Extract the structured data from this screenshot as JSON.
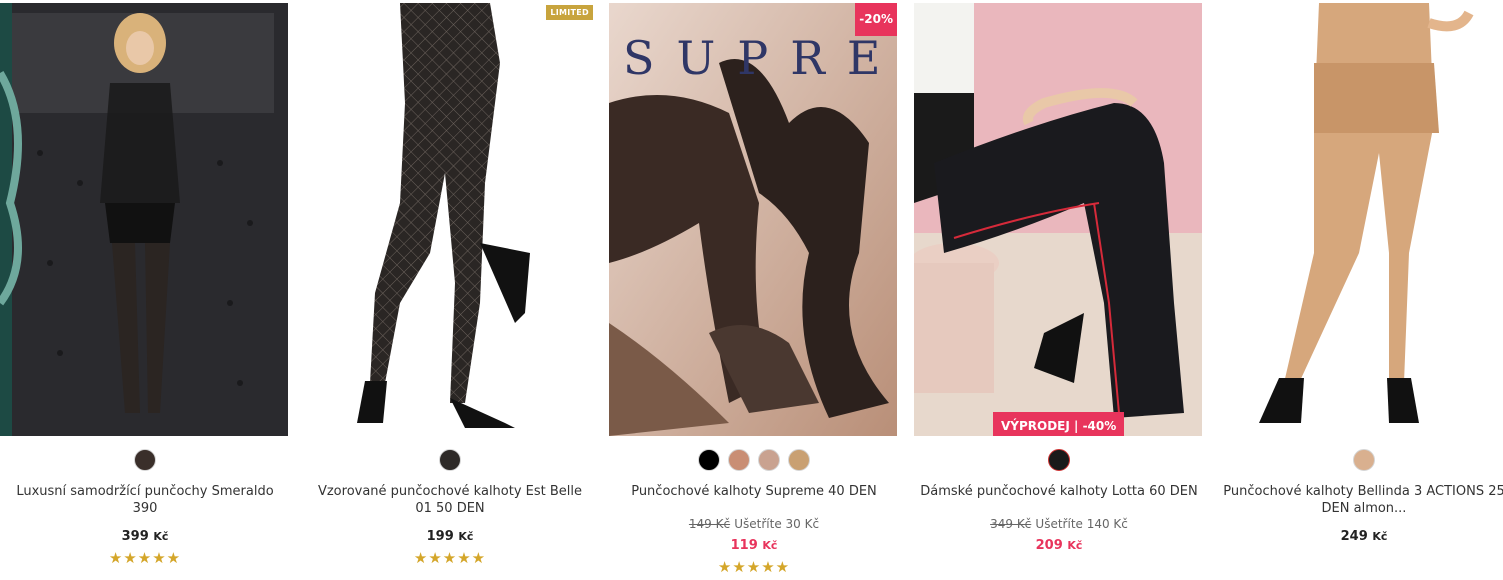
{
  "products": [
    {
      "name": "Luxusní samodržící punčochy Smeraldo 390",
      "price": "399",
      "currency": "Kč",
      "rating": 5,
      "stars": "★★★★★",
      "swatches": [
        "#3a2f2a"
      ]
    },
    {
      "name": "Vzorované punčochové kalhoty Est Belle 01 50 DEN",
      "price": "199",
      "currency": "Kč",
      "badge": "LIMITED",
      "rating": 5,
      "stars": "★★★★★",
      "swatches": [
        "#2e2a28"
      ]
    },
    {
      "name": "Punčochové kalhoty Supreme 40 DEN",
      "image_text": "SUPREM",
      "old_price": "149 Kč",
      "save_text": "Ušetříte 30 Kč",
      "price": "119",
      "currency": "Kč",
      "badge": "-20%",
      "rating": 5,
      "stars": "★★★★★",
      "swatches": [
        "#000000",
        "#c98e74",
        "#c9a290",
        "#c9a072"
      ]
    },
    {
      "name": "Dámské punčochové kalhoty Lotta 60 DEN",
      "old_price": "349 Kč",
      "save_text": "Ušetříte 140 Kč",
      "price": "209",
      "currency": "Kč",
      "badge": "VÝPRODEJ  |  -40%",
      "swatches": [
        "#1a1a1a"
      ]
    },
    {
      "name": "Punčochové kalhoty Bellinda 3 ACTIONS 25 DEN almon...",
      "price": "249",
      "currency": "Kč",
      "swatches": [
        "#d9b08f"
      ]
    }
  ],
  "colors": {
    "accent": "#e8345c",
    "star": "#d4a62a",
    "limited": "#c8a43d"
  }
}
